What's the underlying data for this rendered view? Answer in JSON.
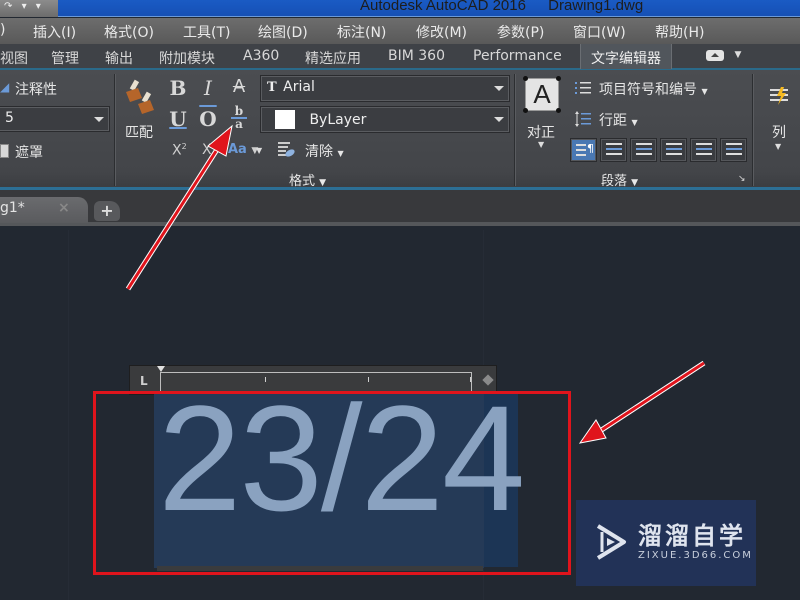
{
  "titlebar": {
    "qat_icons": [
      "redo-icon",
      "dropdown-icon",
      "dropdown-icon"
    ],
    "app_name": "Autodesk AutoCAD 2016",
    "file_name": "Drawing1.dwg"
  },
  "menubar": {
    "items": [
      ")",
      "插入(I)",
      "格式(O)",
      "工具(T)",
      "绘图(D)",
      "标注(N)",
      "修改(M)",
      "参数(P)",
      "窗口(W)",
      "帮助(H)"
    ]
  },
  "ribbon_tabs": {
    "items": [
      "视图",
      "管理",
      "输出",
      "附加模块",
      "A360",
      "精选应用",
      "BIM 360",
      "Performance",
      "文字编辑器"
    ],
    "active": "文字编辑器",
    "extra_icon": "minimize-ribbon-icon"
  },
  "ribbon": {
    "style_panel": {
      "annotative_label": "注释性",
      "text_height_value": "5",
      "mask_label": "遮罩"
    },
    "format_panel": {
      "match_label": "匹配",
      "bold": "B",
      "italic": "I",
      "strikethrough": "A",
      "underline": "U",
      "overline": "O",
      "stack_top": "b",
      "stack_bottom": "a",
      "superscript": "X",
      "superscript_exp": "2",
      "subscript": "X",
      "case_label": "Aa",
      "font_value": "Arial",
      "color_value": "ByLayer",
      "clear_label": "清除",
      "footer": "格式"
    },
    "paragraph_panel": {
      "justify_label": "对正",
      "bullets_label": "项目符号和编号",
      "line_spacing_label": "行距",
      "align_buttons": [
        "left-align",
        "center",
        "center-align",
        "right-align",
        "justify",
        "distribute"
      ],
      "active_align": "left-align",
      "footer": "段落"
    },
    "columns_panel": {
      "label": "列"
    }
  },
  "doc_tabs": {
    "tab_label": "g1*",
    "close_glyph": "×",
    "add_glyph": "+"
  },
  "editor": {
    "text": "23/24"
  },
  "watermark": {
    "name": "溜溜自学",
    "url": "ZIXUE.3D66.COM"
  },
  "annotations": {
    "box_color": "#e0141c",
    "arrow_color": "#e0141c"
  }
}
